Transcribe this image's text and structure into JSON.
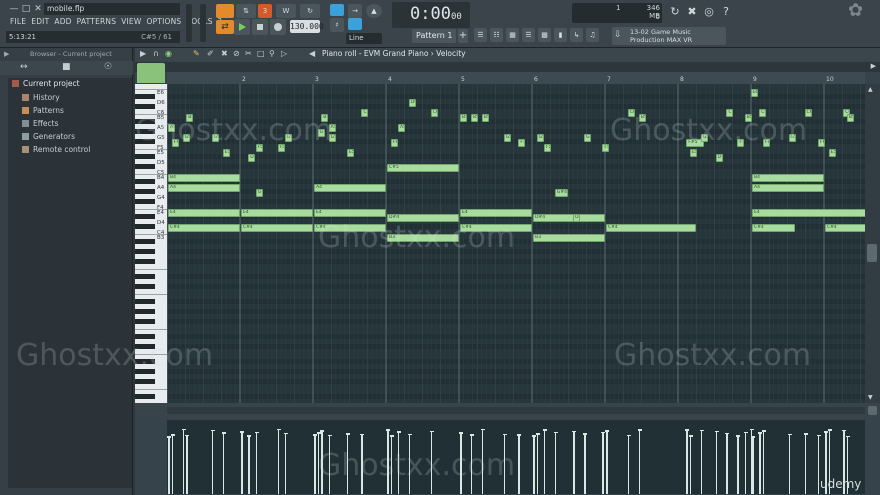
{
  "app": {
    "file_title": "mobile.flp",
    "menu": [
      "FILE",
      "EDIT",
      "ADD",
      "PATTERNS",
      "VIEW",
      "OPTIONS",
      "TOOLS",
      "?"
    ],
    "hint_left": "5:13:21",
    "hint_right": "C#5 / 61"
  },
  "transport": {
    "tempo": "130.000",
    "time": "0:00",
    "time_small": "00",
    "pattern": "Pattern 1",
    "snap": "Line",
    "cpu": "1",
    "memory": "346 MB",
    "polyphony": "0"
  },
  "hint_panel": {
    "line1": "13-02  Game Music",
    "line2": "Production MAX VR"
  },
  "browser": {
    "header": "Browser - Current project",
    "root": "Current project",
    "items": [
      "History",
      "Patterns",
      "Effects",
      "Generators",
      "Remote control"
    ]
  },
  "piano_roll": {
    "title": "Piano roll - EVM Grand Piano › Velocity",
    "bar_numbers": [
      "2",
      "3",
      "4",
      "5",
      "6",
      "7",
      "8",
      "9",
      "10"
    ],
    "key_labels": [
      "E6",
      "D6",
      "C6",
      "B5",
      "A5",
      "G5",
      "F5",
      "E5",
      "D5",
      "C5",
      "B4",
      "A4",
      "G4",
      "F4",
      "E4",
      "D4",
      "C4",
      "B3"
    ]
  },
  "notes": [
    {
      "label": "E6",
      "p": 88
    },
    {
      "label": "D6",
      "p": 86
    },
    {
      "label": "C6",
      "p": 84
    },
    {
      "label": "B5",
      "p": 83
    },
    {
      "label": "G#5",
      "p": 80
    },
    {
      "label": "A5",
      "p": 81
    },
    {
      "label": "F#5",
      "p": 78
    },
    {
      "label": "G5",
      "p": 79
    },
    {
      "label": "E5",
      "p": 76
    },
    {
      "label": "F5",
      "p": 77
    },
    {
      "label": "D#5",
      "p": 75
    },
    {
      "label": "C#5",
      "p": 73
    },
    {
      "label": "B4",
      "p": 71
    },
    {
      "label": "A4",
      "p": 69
    },
    {
      "label": "G#4",
      "p": 68
    },
    {
      "label": "E4",
      "p": 64
    },
    {
      "label": "D#4",
      "p": 63
    },
    {
      "label": "C#4",
      "p": 61
    },
    {
      "label": "B3",
      "p": 59
    }
  ],
  "watermark": "Ghostxx.com",
  "brand": "udemy",
  "colors": {
    "accent": "#e38b2a",
    "note": "#a9dba0",
    "grid": "#26363a",
    "snap_blue": "#3aa2d8",
    "play_green": "#78cf5a"
  }
}
